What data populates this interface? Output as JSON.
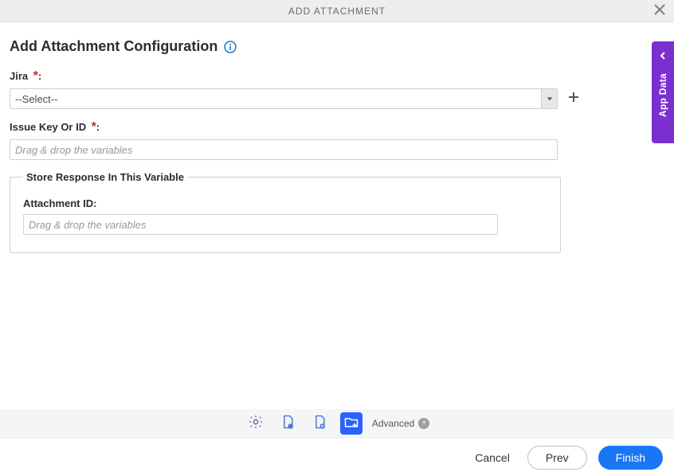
{
  "header": {
    "title": "ADD ATTACHMENT"
  },
  "page": {
    "title": "Add Attachment Configuration"
  },
  "fields": {
    "jira": {
      "label": "Jira",
      "required_mark": "*",
      "colon": ":",
      "selected": "--Select--"
    },
    "issue": {
      "label": "Issue Key Or ID",
      "required_mark": "*",
      "colon": ":",
      "placeholder": "Drag & drop the variables"
    }
  },
  "group": {
    "legend": "Store Response In This Variable",
    "attachment_id": {
      "label": "Attachment ID:",
      "placeholder": "Drag & drop the variables"
    }
  },
  "side_panel": {
    "label": "App Data"
  },
  "toolbar": {
    "advanced_label": "Advanced"
  },
  "footer": {
    "cancel": "Cancel",
    "prev": "Prev",
    "finish": "Finish"
  }
}
